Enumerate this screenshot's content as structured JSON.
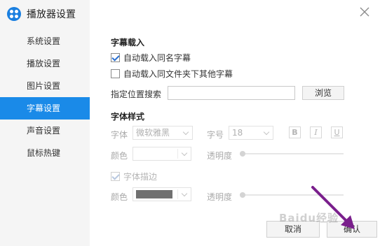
{
  "app": {
    "title": "播放器设置"
  },
  "sidebar": {
    "items": [
      {
        "label": "系统设置",
        "active": false
      },
      {
        "label": "播放设置",
        "active": false
      },
      {
        "label": "图片设置",
        "active": false
      },
      {
        "label": "字幕设置",
        "active": true
      },
      {
        "label": "声音设置",
        "active": false
      },
      {
        "label": "鼠标热键",
        "active": false
      }
    ]
  },
  "subtitle_load": {
    "title": "字幕载入",
    "auto_load_same_name": {
      "label": "自动载入同名字幕",
      "checked": true
    },
    "auto_load_folder": {
      "label": "自动载入同文件夹下其他字幕",
      "checked": false
    },
    "search_path_label": "指定位置搜索",
    "search_path_value": "",
    "browse_label": "浏览"
  },
  "font_style": {
    "title": "字体样式",
    "font_label": "字体",
    "font_value": "微软雅黑",
    "size_label": "字号",
    "size_value": "18",
    "bold_label": "B",
    "italic_label": "I",
    "underline_label": "U",
    "color_label": "颜色",
    "color_value": "#ffffff",
    "opacity_label": "透明度",
    "opacity_value": 0,
    "outline": {
      "label": "字体描边",
      "checked": true
    },
    "outline_color_label": "颜色",
    "outline_color_value": "#707070",
    "outline_opacity_label": "透明度",
    "outline_opacity_value": 0
  },
  "footer": {
    "cancel_label": "取消",
    "confirm_label": "确认"
  },
  "overlay": {
    "watermark_text": "Baidu经验"
  },
  "colors": {
    "accent": "#1a8ae8",
    "arrow": "#7a1f8c"
  }
}
